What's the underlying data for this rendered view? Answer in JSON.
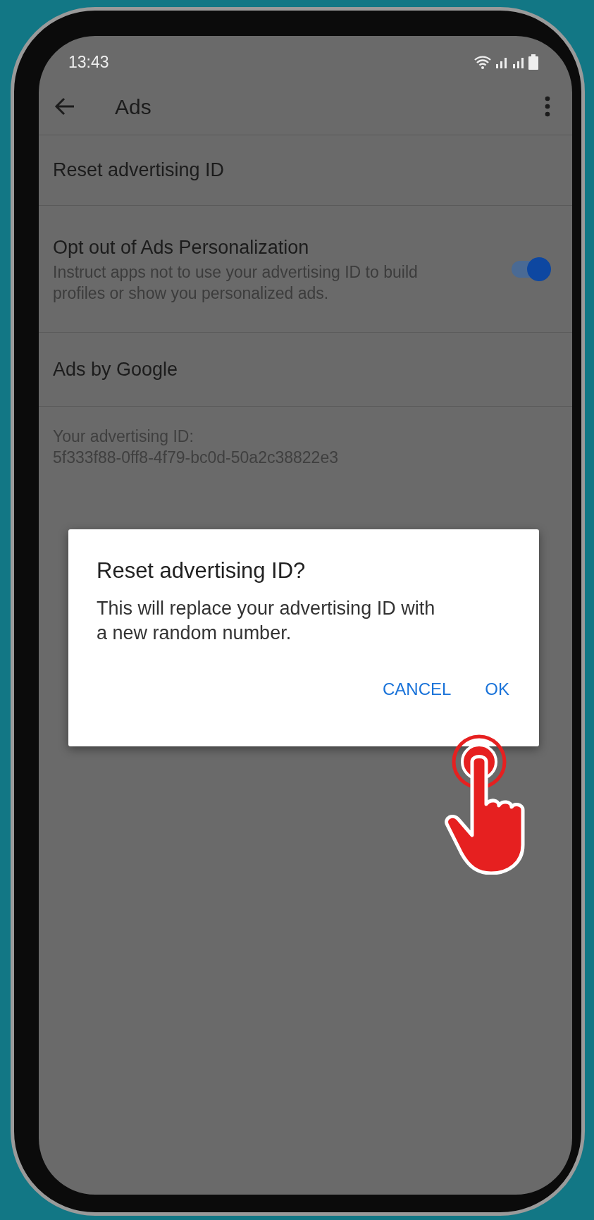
{
  "status_bar": {
    "time": "13:43"
  },
  "toolbar": {
    "title": "Ads"
  },
  "settings": [
    {
      "kind": "action",
      "title": "Reset advertising ID"
    },
    {
      "kind": "toggle",
      "title": "Opt out of Ads Personalization",
      "summary": "Instruct apps not to use your advertising ID to build profiles or show you personalized ads.",
      "on": true
    },
    {
      "kind": "action",
      "title": "Ads by Google"
    }
  ],
  "advertising_id": {
    "label": "Your advertising ID:",
    "value": "5f333f88-0ff8-4f79-bc0d-50a2c38822e3"
  },
  "dialog": {
    "title": "Reset advertising ID?",
    "message": "This will replace your advertising ID with a new random number.",
    "buttons": [
      "CANCEL",
      "OK"
    ]
  }
}
